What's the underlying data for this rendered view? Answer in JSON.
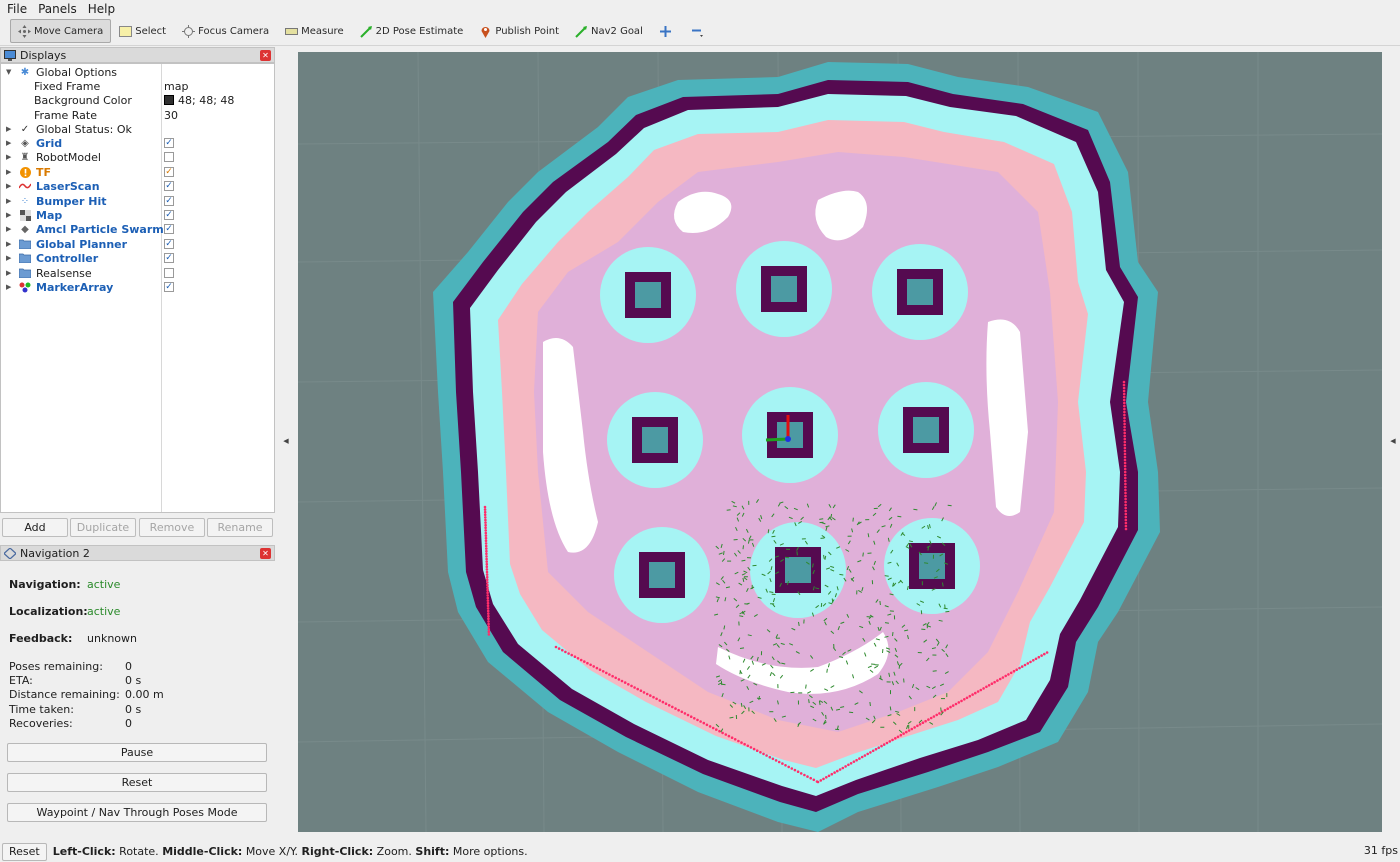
{
  "menu": [
    "File",
    "Panels",
    "Help"
  ],
  "toolbar": {
    "move_camera": "Move Camera",
    "select": "Select",
    "focus_camera": "Focus Camera",
    "measure": "Measure",
    "pose_estimate": "2D Pose Estimate",
    "publish_point": "Publish Point",
    "nav2_goal": "Nav2 Goal"
  },
  "displays_panel": {
    "title": "Displays",
    "global_options": "Global Options",
    "fixed_frame_label": "Fixed Frame",
    "fixed_frame_value": "map",
    "background_color_label": "Background Color",
    "background_color_value": "48; 48; 48",
    "frame_rate_label": "Frame Rate",
    "frame_rate_value": "30",
    "global_status": "Global Status: Ok",
    "items": [
      {
        "label": "Grid",
        "checked": true
      },
      {
        "label": "RobotModel",
        "checked": false
      },
      {
        "label": "TF",
        "checked": true
      },
      {
        "label": "LaserScan",
        "checked": true
      },
      {
        "label": "Bumper Hit",
        "checked": true
      },
      {
        "label": "Map",
        "checked": true
      },
      {
        "label": "Amcl Particle Swarm",
        "checked": true
      },
      {
        "label": "Global Planner",
        "checked": true
      },
      {
        "label": "Controller",
        "checked": true
      },
      {
        "label": "Realsense",
        "checked": false
      },
      {
        "label": "MarkerArray",
        "checked": true
      }
    ],
    "buttons": {
      "add": "Add",
      "duplicate": "Duplicate",
      "remove": "Remove",
      "rename": "Rename"
    }
  },
  "navigation_panel": {
    "title": "Navigation 2",
    "navigation_label": "Navigation:",
    "navigation_value": "active",
    "localization_label": "Localization:",
    "localization_value": "active",
    "feedback_label": "Feedback:",
    "feedback_value": "unknown",
    "poses_remaining_label": "Poses remaining:",
    "poses_remaining_value": "0",
    "eta_label": "ETA:",
    "eta_value": "0 s",
    "distance_label": "Distance remaining:",
    "distance_value": "0.00 m",
    "time_label": "Time taken:",
    "time_value": "0 s",
    "recoveries_label": "Recoveries:",
    "recoveries_value": "0",
    "pause": "Pause",
    "reset": "Reset",
    "waypoint_mode": "Waypoint / Nav Through Poses Mode"
  },
  "statusbar": {
    "reset": "Reset",
    "left_click": "Left-Click:",
    "left_click_action": "Rotate.",
    "middle_click": "Middle-Click:",
    "middle_click_action": "Move X/Y.",
    "right_click": "Right-Click:",
    "right_click_action": "Zoom.",
    "shift": "Shift:",
    "shift_action": "More options.",
    "fps": "31 fps"
  },
  "colors": {
    "viewport_bg": "#6e8181",
    "costmap_teal": "#4cb3bb",
    "inflation_dark": "#550a50",
    "inflation_cyan": "#a6f4f4",
    "inflation_pink": "#f5b8c2",
    "inflation_lavender": "#d8aee0",
    "accent_blue": "#1c5fb5",
    "status_green": "#2a8a2a"
  }
}
